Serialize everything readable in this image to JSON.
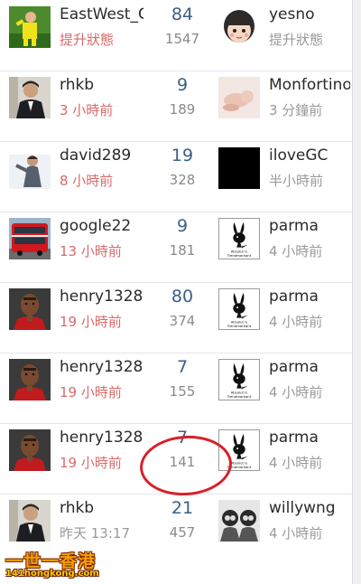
{
  "rows": [
    {
      "left": {
        "user": "EastWest_G",
        "time": "提升狀態",
        "avatar": "soccer-player-yellow"
      },
      "replies": "84",
      "views": "1547",
      "right": {
        "user": "yesno",
        "time": "提升狀態",
        "avatar": "cartoon-girl"
      }
    },
    {
      "left": {
        "user": "rhkb",
        "time": "3 小時前",
        "avatar": "man-in-suit"
      },
      "replies": "9",
      "views": "189",
      "right": {
        "user": "Monfortino",
        "time": "3 分鐘前",
        "avatar": "sleeping-baby"
      }
    },
    {
      "left": {
        "user": "david289",
        "time": "8 小時前",
        "avatar": "model-photo"
      },
      "replies": "19",
      "views": "328",
      "right": {
        "user": "iloveGC",
        "time": "半小時前",
        "avatar": "black-square"
      }
    },
    {
      "left": {
        "user": "google22",
        "time": "13 小時前",
        "avatar": "red-double-decker-bus"
      },
      "replies": "9",
      "views": "181",
      "right": {
        "user": "parma",
        "time": "4 小時前",
        "avatar": "bunny-logo"
      }
    },
    {
      "left": {
        "user": "henry1328",
        "time": "19 小時前",
        "avatar": "football-player-portrait"
      },
      "replies": "80",
      "views": "374",
      "right": {
        "user": "parma",
        "time": "4 小時前",
        "avatar": "bunny-logo"
      }
    },
    {
      "left": {
        "user": "henry1328",
        "time": "19 小時前",
        "avatar": "football-player-portrait"
      },
      "replies": "7",
      "views": "155",
      "right": {
        "user": "parma",
        "time": "4 小時前",
        "avatar": "bunny-logo"
      }
    },
    {
      "left": {
        "user": "henry1328",
        "time": "19 小時前",
        "avatar": "football-player-portrait"
      },
      "replies": "7",
      "views": "141",
      "right": {
        "user": "parma",
        "time": "4 小時前",
        "avatar": "bunny-logo"
      }
    },
    {
      "left": {
        "user": "rhkb",
        "time": "昨天 13:17",
        "avatar": "man-in-suit"
      },
      "replies": "21",
      "views": "457",
      "right": {
        "user": "willywng",
        "time": "4 小時前",
        "avatar": "two-figures"
      }
    }
  ],
  "bunny_caption": "Absolut is Trendmarkant",
  "watermark": {
    "title": "一世一香港",
    "url": "141hongkong.com"
  },
  "colors": {
    "accent_red": "#d96a6a",
    "count_blue": "#3b5f86",
    "circle": "#d8202a"
  }
}
